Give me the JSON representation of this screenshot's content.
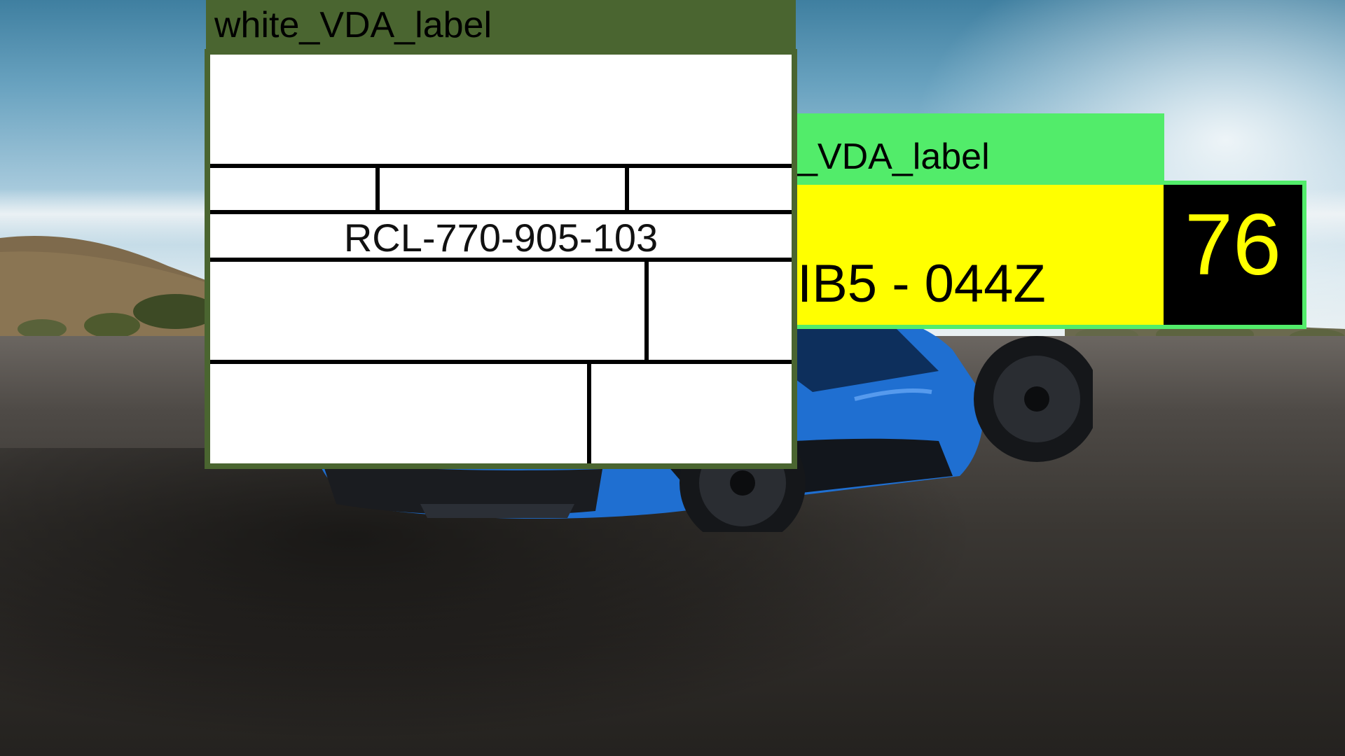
{
  "annotations": [
    {
      "label": "white_VDA_label",
      "color": "#4a6530",
      "part_number": "RCL-770-905-103"
    },
    {
      "label": "_VDA_label",
      "color": "#52ec6a",
      "plate_text": "IB5 - 044Z",
      "plate_number": "76",
      "plate_background": "#ffff00",
      "number_background": "#000000",
      "number_color": "#ffff00"
    }
  ],
  "scene": {
    "background": "photo of a blue sports car on asphalt under a sunny sky",
    "car_color": "#1f6fd1"
  }
}
